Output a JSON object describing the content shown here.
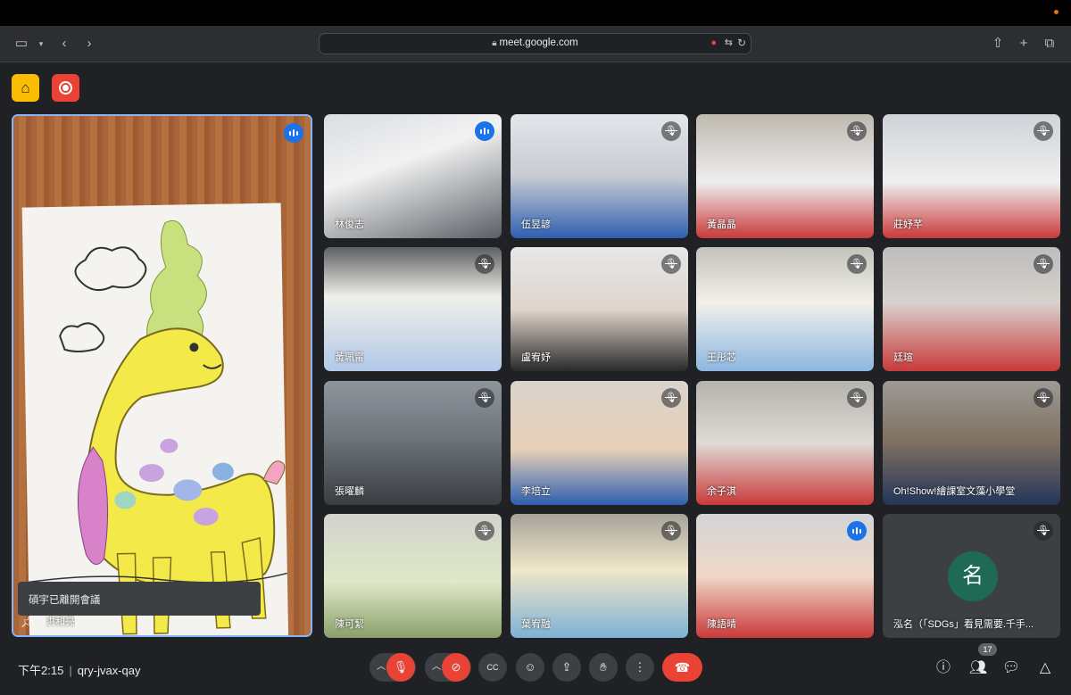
{
  "browser": {
    "url": "meet.google.com"
  },
  "meeting": {
    "host_badge_icon": "door-icon",
    "record_badge_icon": "record-icon",
    "toast": "碩宇已離開會議",
    "time": "下午2:15",
    "code": "qry-jvax-qay",
    "participant_count": "17"
  },
  "pinned": {
    "name": "洪和亮"
  },
  "tiles": [
    {
      "name": "林俊志",
      "mic": "speaking"
    },
    {
      "name": "伍昱諺",
      "mic": "muted"
    },
    {
      "name": "黃晶晶",
      "mic": "muted"
    },
    {
      "name": "莊妤芊",
      "mic": "muted"
    },
    {
      "name": "黃珮甯",
      "mic": "muted"
    },
    {
      "name": "盧宥妤",
      "mic": "muted"
    },
    {
      "name": "王彤芯",
      "mic": "muted"
    },
    {
      "name": "廷瑄",
      "mic": "muted"
    },
    {
      "name": "張曜麟",
      "mic": "muted"
    },
    {
      "name": "李培立",
      "mic": "muted"
    },
    {
      "name": "余子淇",
      "mic": "muted"
    },
    {
      "name": "Oh!Show!繪課室文藻小學堂",
      "mic": "muted"
    },
    {
      "name": "陳可絜",
      "mic": "muted"
    },
    {
      "name": "葉宥融",
      "mic": "muted"
    },
    {
      "name": "陳語晴",
      "mic": "speaking"
    },
    {
      "name": "泓名（「SDGs」看見需要.千手...",
      "mic": "muted",
      "avatar": "名"
    }
  ],
  "colors": {
    "red": "#ea4335",
    "yellow": "#fbbc04",
    "speak_blue": "#1a73e8",
    "pin_border": "#8ab4f8"
  }
}
